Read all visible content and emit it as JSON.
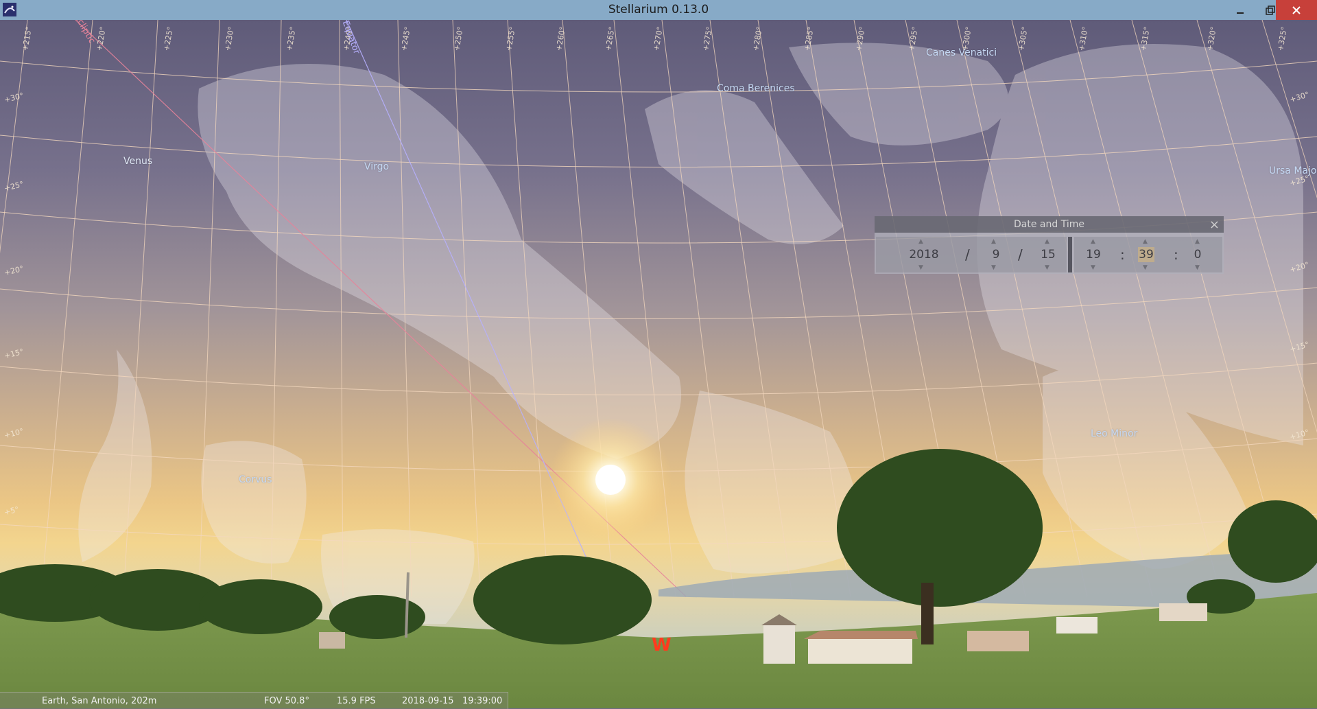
{
  "window": {
    "title": "Stellarium 0.13.0",
    "controls": {
      "minimize_icon": "minimize-icon",
      "maximize_icon": "maximize-icon",
      "close_icon": "close-icon"
    }
  },
  "sky": {
    "constellations": [
      {
        "id": "virgo",
        "label": "Virgo"
      },
      {
        "id": "coma",
        "label": "Coma Berenices"
      },
      {
        "id": "canes",
        "label": "Canes Venatici"
      },
      {
        "id": "corvus",
        "label": "Corvus"
      },
      {
        "id": "leo-minor",
        "label": "Leo Minor"
      },
      {
        "id": "ursa-major",
        "label": "Ursa Major"
      }
    ],
    "bodies": [
      {
        "id": "venus",
        "label": "Venus"
      }
    ],
    "line_labels": {
      "ecliptic": "Ecliptic",
      "equator": "Equator"
    },
    "cardinal": "W",
    "altitudes_left": [
      "+5°",
      "+10°",
      "+15°",
      "+20°",
      "+25°",
      "+30°"
    ],
    "altitudes_right": [
      "+15°",
      "+20°",
      "+25°",
      "+30°",
      "+10°"
    ],
    "azimuths_top": [
      "+215°",
      "+220°",
      "+225°",
      "+230°",
      "+235°",
      "+240°",
      "+245°",
      "+250°",
      "+255°",
      "+260°",
      "+265°",
      "+270°",
      "+275°",
      "+280°",
      "+285°",
      "+290°",
      "+295°",
      "+300°",
      "+305°",
      "+310°",
      "+315°",
      "+320°",
      "+325°"
    ]
  },
  "date_time_dialog": {
    "title": "Date and Time",
    "close_icon": "close-icon",
    "year": "2018",
    "month": "9",
    "day": "15",
    "hour": "19",
    "minute": "39",
    "second": "0",
    "date_sep": "/",
    "time_sep": ":"
  },
  "status": {
    "location": "Earth, San Antonio, 202m",
    "fov": "FOV 50.8°",
    "fps": "15.9 FPS",
    "datetime": "2018-09-15   19:39:00"
  }
}
